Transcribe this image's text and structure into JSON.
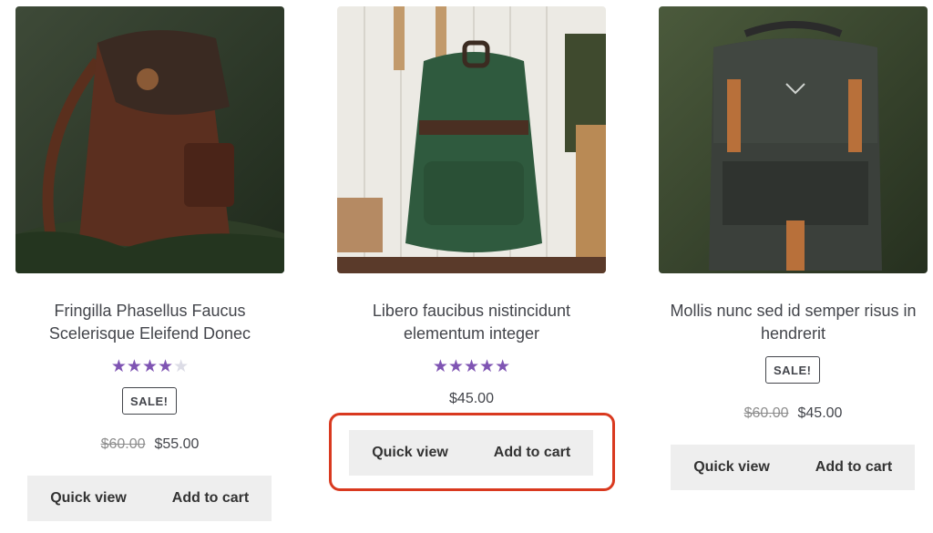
{
  "products": [
    {
      "title_line1": "Fringilla Phasellus Faucus",
      "title_line2": "Scelerisque Eleifend Donec",
      "rating": 4,
      "rating_max": 5,
      "sale_badge": "SALE!",
      "price_old": "$60.00",
      "price": "$55.00",
      "quick_view": "Quick view",
      "add_to_cart": "Add to cart",
      "image_icon": "brown-leather-backpack"
    },
    {
      "title_line1": "Libero faucibus nistincidunt",
      "title_line2": "elementum integer",
      "rating": 5,
      "rating_max": 5,
      "price": "$45.00",
      "quick_view": "Quick view",
      "add_to_cart": "Add to cart",
      "image_icon": "green-canvas-backpack"
    },
    {
      "title_line1": "Mollis nunc sed id semper risus in",
      "title_line2": "hendrerit",
      "sale_badge": "SALE!",
      "price_old": "$60.00",
      "price": "$45.00",
      "quick_view": "Quick view",
      "add_to_cart": "Add to cart",
      "image_icon": "dark-grey-backpack"
    }
  ],
  "colors": {
    "star": "#7f54b3",
    "button_bg": "#eeeeee",
    "highlight": "#d9391f"
  }
}
